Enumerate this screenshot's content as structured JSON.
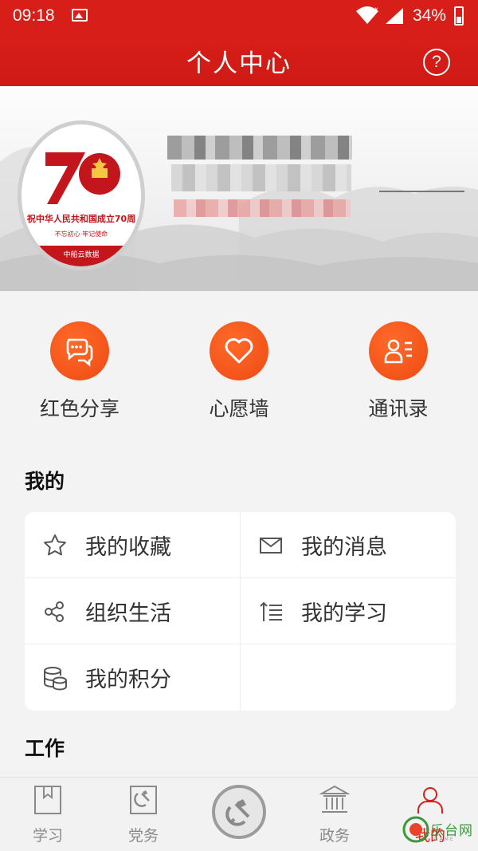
{
  "status_bar": {
    "time": "09:18",
    "battery": "34%"
  },
  "header": {
    "title": "个人中心",
    "help_symbol": "?"
  },
  "avatar": {
    "logo_number": "70",
    "caption": "祝中华人民共和国成立70周",
    "slogan": "不忘初心·牢记使命",
    "footer": "中船云数据"
  },
  "quick_actions": [
    {
      "label": "红色分享",
      "icon": "chat-bubbles-icon"
    },
    {
      "label": "心愿墙",
      "icon": "heart-icon"
    },
    {
      "label": "通讯录",
      "icon": "contacts-icon"
    }
  ],
  "sections": {
    "mine": "我的",
    "work": "工作"
  },
  "my_items": [
    {
      "label": "我的收藏",
      "icon": "star-icon"
    },
    {
      "label": "我的消息",
      "icon": "envelope-icon"
    },
    {
      "label": "组织生活",
      "icon": "share-nodes-icon"
    },
    {
      "label": "我的学习",
      "icon": "study-list-icon"
    },
    {
      "label": "我的积分",
      "icon": "coins-database-icon"
    }
  ],
  "tabs": [
    {
      "label": "学习",
      "icon": "bookmark-book-icon"
    },
    {
      "label": "党务",
      "icon": "party-emblem-box-icon"
    },
    {
      "label": "",
      "icon": "party-emblem-icon"
    },
    {
      "label": "政务",
      "icon": "government-building-icon"
    },
    {
      "label": "我的",
      "icon": "user-icon"
    }
  ],
  "watermark": {
    "text": "乐台网",
    "sub": "GAME"
  },
  "colors": {
    "primary": "#d81e18",
    "accent_orange": "#f05018",
    "tab_inactive": "#8a8a8a"
  }
}
